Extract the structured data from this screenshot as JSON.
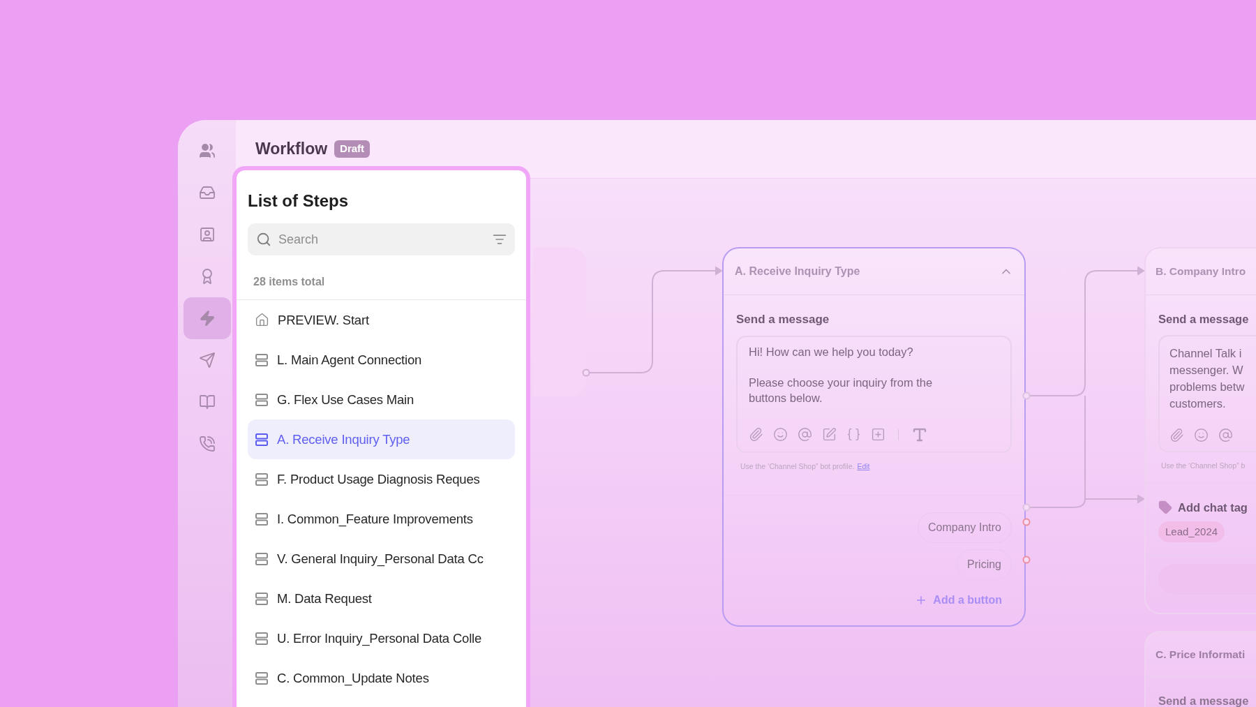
{
  "rail": [
    {
      "kind": "people",
      "selected": false
    },
    {
      "kind": "inbox",
      "selected": false
    },
    {
      "kind": "contact",
      "selected": false
    },
    {
      "kind": "award",
      "selected": false
    },
    {
      "kind": "bolt",
      "selected": true
    },
    {
      "kind": "send",
      "selected": false
    },
    {
      "kind": "book",
      "selected": false
    },
    {
      "kind": "phone",
      "selected": false
    }
  ],
  "header": {
    "title": "Workflow",
    "badge": "Draft"
  },
  "steps_panel": {
    "title": "List of Steps",
    "search": {
      "placeholder": "Search"
    },
    "count": "28 items total",
    "items": [
      {
        "label": "PREVIEW. Start",
        "kind": "start",
        "selected": false
      },
      {
        "label": "L. Main Agent Connection",
        "kind": "step",
        "selected": false
      },
      {
        "label": "G. Flex Use Cases Main",
        "kind": "step",
        "selected": false
      },
      {
        "label": "A. Receive Inquiry Type",
        "kind": "step",
        "selected": true
      },
      {
        "label": "F. Product Usage Diagnosis Reques",
        "kind": "step",
        "selected": false
      },
      {
        "label": "I. Common_Feature Improvements",
        "kind": "step",
        "selected": false
      },
      {
        "label": "V. General Inquiry_Personal Data Cc",
        "kind": "step",
        "selected": false
      },
      {
        "label": "M. Data Request",
        "kind": "step",
        "selected": false
      },
      {
        "label": "U. Error Inquiry_Personal Data Colle",
        "kind": "step",
        "selected": false
      },
      {
        "label": "C. Common_Update Notes",
        "kind": "step",
        "selected": false
      }
    ]
  },
  "nodes": [
    {
      "title": "A. Receive Inquiry Type",
      "selected": true,
      "expanded": true,
      "section": "Send a message",
      "message": [
        "Hi! How can we help you today?",
        "Please choose your inquiry from the buttons below."
      ],
      "note": "Use the ‘Channel Shop” bot profile.",
      "note_link": "Edit",
      "buttons": [
        "Company Intro",
        "Pricing"
      ],
      "add_button": "Add a button"
    },
    {
      "title": "B. Company Intro",
      "selected": false,
      "section": "Send a message",
      "message_lines": [
        "Channel Talk i",
        "messenger. W",
        "problems betw",
        "customers."
      ],
      "note": "Use the ‘Channel Shop” b",
      "tag_action": "Add chat tag",
      "tags": [
        "Lead_2024"
      ]
    },
    {
      "title": "C. Price Informati",
      "selected": false,
      "section": "Send a message"
    }
  ]
}
